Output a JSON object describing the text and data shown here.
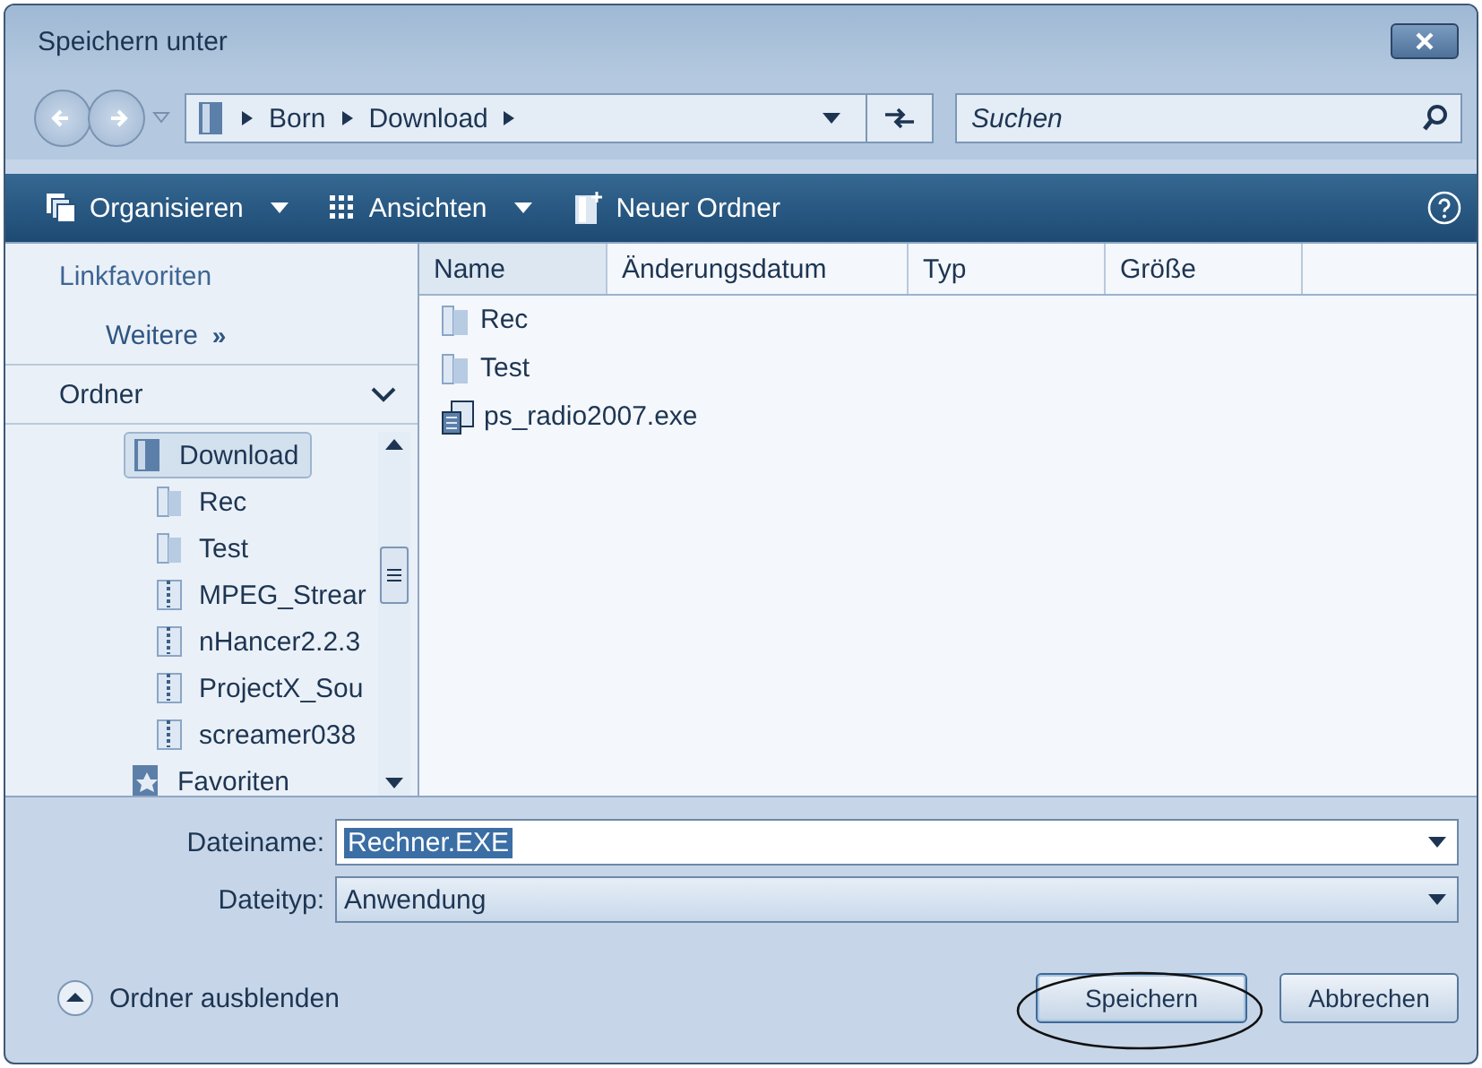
{
  "window": {
    "title": "Speichern unter"
  },
  "address": {
    "path": [
      "Born",
      "Download"
    ]
  },
  "search": {
    "placeholder": "Suchen"
  },
  "toolbar": [
    {
      "label": "Organisieren",
      "kind": "organize"
    },
    {
      "label": "Ansichten",
      "kind": "views"
    },
    {
      "label": "Neuer Ordner",
      "kind": "newfolder"
    }
  ],
  "favorites": {
    "title": "Linkfavoriten",
    "more": "Weitere",
    "more_icon": "»"
  },
  "folders": {
    "title": "Ordner",
    "tree": [
      {
        "label": "Download",
        "kind": "folder",
        "selected": true,
        "children": [
          {
            "label": "Rec",
            "kind": "folder",
            "selected": false
          },
          {
            "label": "Test",
            "kind": "folder",
            "selected": false
          },
          {
            "label": "MPEG_Strear",
            "kind": "archive",
            "selected": false
          },
          {
            "label": "nHancer2.2.3",
            "kind": "archive",
            "selected": false
          },
          {
            "label": "ProjectX_Sou",
            "kind": "archive",
            "selected": false
          },
          {
            "label": "screamer038",
            "kind": "archive",
            "selected": false
          }
        ]
      },
      {
        "label": "Favoriten",
        "kind": "favorites",
        "selected": false
      }
    ]
  },
  "table": {
    "columns": [
      "Name",
      "Änderungsdatum",
      "Typ",
      "Größe"
    ],
    "rows": [
      {
        "name": "Rec",
        "kind": "folder"
      },
      {
        "name": "Test",
        "kind": "folder"
      },
      {
        "name": "ps_radio2007.exe",
        "kind": "exe"
      }
    ]
  },
  "filename": {
    "label": "Dateiname:",
    "value": "Rechner.EXE"
  },
  "filetype": {
    "label": "Dateityp:",
    "value": "Anwendung"
  },
  "hide_folders": "Ordner ausblenden",
  "buttons": [
    {
      "label": "Speichern",
      "kind": "primary",
      "circled": true
    },
    {
      "label": "Abbrechen",
      "kind": "normal",
      "circled": false
    }
  ]
}
